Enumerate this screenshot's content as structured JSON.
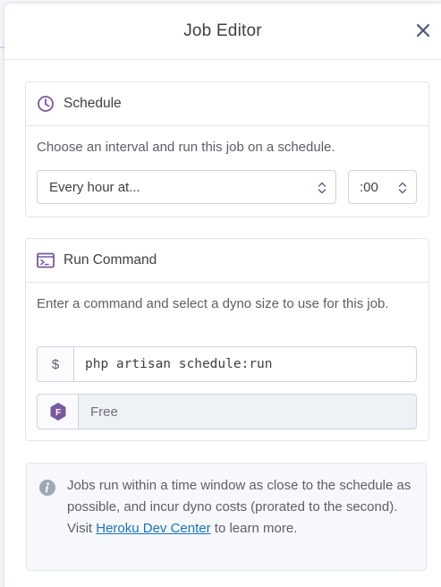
{
  "header": {
    "title": "Job Editor"
  },
  "icons": {
    "close": "close-icon",
    "schedule": "clock-icon",
    "command": "terminal-icon",
    "dyno": "dyno-hexagon-icon",
    "info": "info-icon"
  },
  "colors": {
    "accent": "#79589f",
    "link": "#1874c1",
    "border": "#e3e5ec"
  },
  "schedule": {
    "title": "Schedule",
    "description": "Choose an interval and run this job on a schedule.",
    "interval_value": "Every hour at...",
    "minute_value": ":00"
  },
  "command": {
    "title": "Run Command",
    "description": "Enter a command and select a dyno size to use for this job.",
    "prefix": "$",
    "value": "php artisan schedule:run",
    "dyno_badge": "F",
    "dyno_value": "Free"
  },
  "info": {
    "text_before": "Jobs run within a time window as close to the schedule as possible, and incur dyno costs (prorated to the second). Visit ",
    "link_text": "Heroku Dev Center",
    "text_after": " to learn more."
  }
}
